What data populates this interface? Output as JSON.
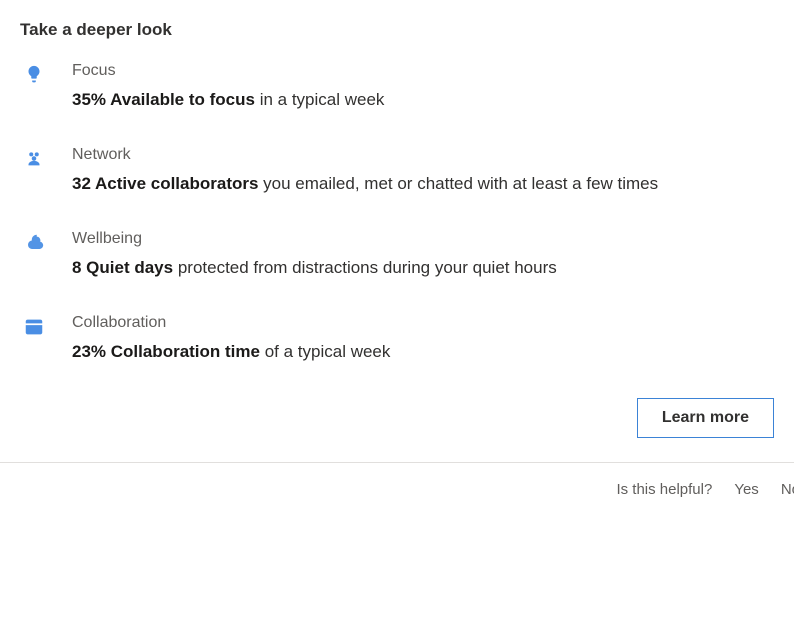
{
  "heading": "Take a deeper look",
  "sections": [
    {
      "icon": "lightbulb",
      "title": "Focus",
      "bold": "35% Available to focus",
      "rest": " in a typical week"
    },
    {
      "icon": "people",
      "title": "Network",
      "bold": "32 Active collaborators",
      "rest": " you emailed, met or chatted with at least a few times"
    },
    {
      "icon": "moon-cloud",
      "title": "Wellbeing",
      "bold": "8 Quiet days",
      "rest": " protected from distractions during your quiet hours"
    },
    {
      "icon": "calendar",
      "title": "Collaboration",
      "bold": "23% Collaboration time",
      "rest": " of a typical week"
    }
  ],
  "actions": {
    "learn_more": "Learn more"
  },
  "feedback": {
    "question": "Is this helpful?",
    "yes": "Yes",
    "no": "No"
  }
}
